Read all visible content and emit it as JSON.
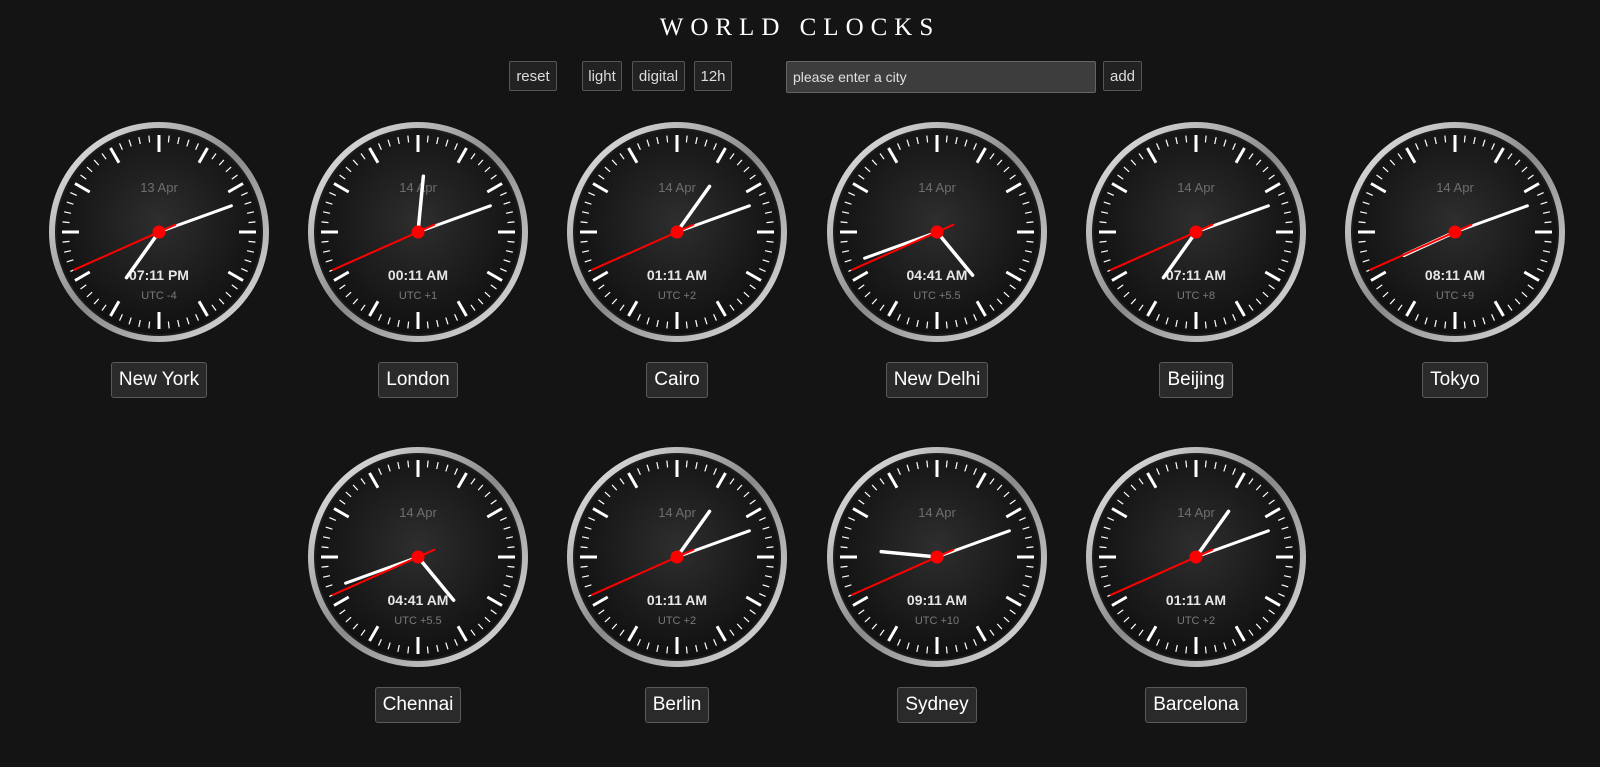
{
  "title": "WORLD CLOCKS",
  "toolbar": {
    "reset_label": "reset",
    "light_label": "light",
    "digital_label": "digital",
    "format_label": "12h",
    "city_placeholder": "please enter a city",
    "add_label": "add"
  },
  "clocks": [
    {
      "city": "New York",
      "date": "13 Apr",
      "time": "07:11 PM",
      "utc": "UTC -4",
      "hands": {
        "hour": 7,
        "minute": 11,
        "second": 41
      }
    },
    {
      "city": "London",
      "date": "14 Apr",
      "time": "00:11 AM",
      "utc": "UTC +1",
      "hands": {
        "hour": 0,
        "minute": 11,
        "second": 41
      }
    },
    {
      "city": "Cairo",
      "date": "14 Apr",
      "time": "01:11 AM",
      "utc": "UTC +2",
      "hands": {
        "hour": 1,
        "minute": 11,
        "second": 41
      }
    },
    {
      "city": "New Delhi",
      "date": "14 Apr",
      "time": "04:41 AM",
      "utc": "UTC +5.5",
      "hands": {
        "hour": 4,
        "minute": 41,
        "second": 41
      }
    },
    {
      "city": "Beijing",
      "date": "14 Apr",
      "time": "07:11 AM",
      "utc": "UTC +8",
      "hands": {
        "hour": 7,
        "minute": 11,
        "second": 41
      }
    },
    {
      "city": "Tokyo",
      "date": "14 Apr",
      "time": "08:11 AM",
      "utc": "UTC +9",
      "hands": {
        "hour": 8,
        "minute": 11,
        "second": 41
      }
    },
    {
      "city": "Chennai",
      "date": "14 Apr",
      "time": "04:41 AM",
      "utc": "UTC +5.5",
      "hands": {
        "hour": 4,
        "minute": 41,
        "second": 41
      }
    },
    {
      "city": "Berlin",
      "date": "14 Apr",
      "time": "01:11 AM",
      "utc": "UTC +2",
      "hands": {
        "hour": 1,
        "minute": 11,
        "second": 41
      }
    },
    {
      "city": "Sydney",
      "date": "14 Apr",
      "time": "09:11 AM",
      "utc": "UTC +10",
      "hands": {
        "hour": 9,
        "minute": 11,
        "second": 41
      }
    },
    {
      "city": "Barcelona",
      "date": "14 Apr",
      "time": "01:11 AM",
      "utc": "UTC +2",
      "hands": {
        "hour": 1,
        "minute": 11,
        "second": 41
      }
    }
  ],
  "colors": {
    "background": "#141414",
    "second_hand": "#ff0000",
    "hands": "#ffffff"
  }
}
